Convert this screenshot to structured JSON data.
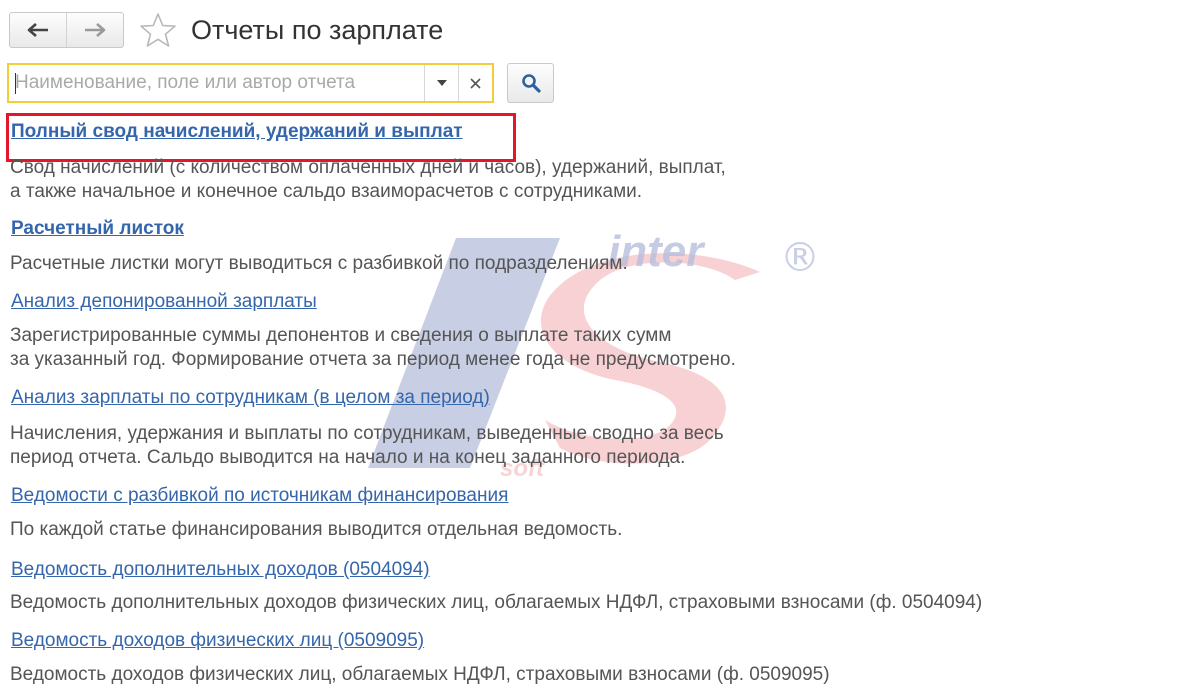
{
  "header": {
    "title": "Отчеты по зарплате",
    "back_icon": "arrow-left-icon",
    "forward_icon": "arrow-right-icon",
    "favorite_icon": "star-outline-icon"
  },
  "search": {
    "placeholder": "Наименование, поле или автор отчета",
    "value": "",
    "dropdown_icon": "caret-down-icon",
    "clear_icon": "close-icon",
    "button_icon": "search-icon"
  },
  "reports": [
    {
      "title": "Полный свод начислений, удержаний и выплат",
      "description": [
        "Свод начислений (с количеством оплаченных дней и часов), удержаний, выплат,",
        "а также начальное и конечное сальдо взаиморасчетов с сотрудниками."
      ],
      "highlighted": true
    },
    {
      "title": "Расчетный листок",
      "description": [
        "Расчетные листки могут выводиться с разбивкой по подразделениям."
      ]
    },
    {
      "title": "Анализ депонированной зарплаты",
      "description": [
        "Зарегистрированные суммы депонентов и сведения о выплате таких сумм",
        "за указанный год. Формирование отчета за период менее года не предусмотрено."
      ]
    },
    {
      "title": "Анализ зарплаты по сотрудникам (в целом за период)",
      "description": [
        "Начисления, удержания и выплаты по сотрудникам, выведенные сводно за весь",
        "период отчета. Сальдо выводится на начало и на конец заданного периода."
      ]
    },
    {
      "title": "Ведомости с разбивкой по источникам финансирования",
      "description": [
        "По каждой статье финансирования выводится отдельная ведомость."
      ]
    },
    {
      "title": "Ведомость дополнительных доходов (0504094)",
      "description": [
        "Ведомость дополнительных доходов физических лиц, облагаемых НДФЛ, страховыми взносами (ф. 0504094)"
      ]
    },
    {
      "title": "Ведомость доходов физических лиц (0509095)",
      "description": [
        "Ведомость доходов физических лиц, облагаемых НДФЛ, страховыми взносами (ф. 0509095)"
      ]
    }
  ],
  "watermark": {
    "text": "inter",
    "sub_text": "soft",
    "mark": "®"
  },
  "colors": {
    "link": "#3566ab",
    "highlight_frame": "#e3162a",
    "search_focus_border": "#f2cc3a",
    "watermark_blue": "#b6bfdc",
    "watermark_red": "#f7c9cc"
  }
}
